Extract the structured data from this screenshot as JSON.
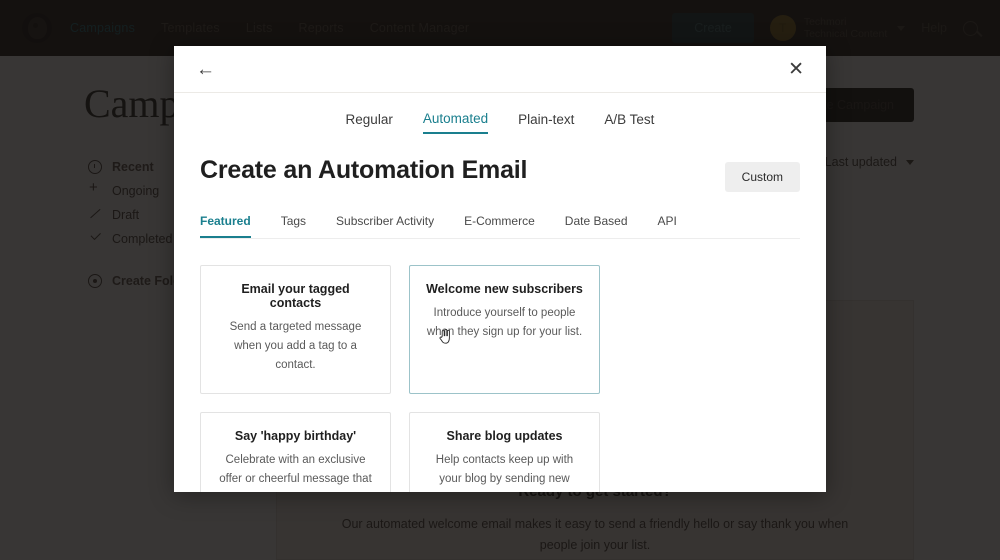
{
  "topnav": {
    "logo_alt": "Mailchimp",
    "links": [
      {
        "label": "Campaigns",
        "active": true
      },
      {
        "label": "Templates",
        "active": false
      },
      {
        "label": "Lists",
        "active": false
      },
      {
        "label": "Reports",
        "active": false
      },
      {
        "label": "Content Manager",
        "active": false
      }
    ],
    "create_label": "Create",
    "account": {
      "initial": "T",
      "name": "Techmori",
      "org": "Technical Content"
    },
    "help_label": "Help"
  },
  "page": {
    "title": "Campaigns",
    "create_campaign_label": "Create Campaign",
    "sort_label": "Last updated",
    "sidebar": [
      {
        "label": "Recent",
        "icon": "clock-icon",
        "active": true
      },
      {
        "label": "Ongoing",
        "icon": "plus-icon",
        "active": false
      },
      {
        "label": "Draft",
        "icon": "pencil-icon",
        "active": false
      },
      {
        "label": "Completed",
        "icon": "check-icon",
        "active": false
      },
      {
        "label": "Create Folder",
        "icon": "target-icon",
        "active": false
      }
    ],
    "promo": {
      "heading": "Ready to get started?",
      "body": "Our automated welcome email makes it easy to send a friendly hello or say thank you when people join your list."
    }
  },
  "modal": {
    "back_icon": "←",
    "close_icon": "✕",
    "tabs": [
      {
        "label": "Regular",
        "active": false
      },
      {
        "label": "Automated",
        "active": true
      },
      {
        "label": "Plain-text",
        "active": false
      },
      {
        "label": "A/B Test",
        "active": false
      }
    ],
    "title": "Create an Automation Email",
    "custom_label": "Custom",
    "subtabs": [
      {
        "label": "Featured",
        "active": true
      },
      {
        "label": "Tags",
        "active": false
      },
      {
        "label": "Subscriber Activity",
        "active": false
      },
      {
        "label": "E-Commerce",
        "active": false
      },
      {
        "label": "Date Based",
        "active": false
      },
      {
        "label": "API",
        "active": false
      }
    ],
    "cards": [
      {
        "title": "Email your tagged contacts",
        "desc": "Send a targeted message when you add a tag to a contact.",
        "selected": false
      },
      {
        "title": "Welcome new subscribers",
        "desc": "Introduce yourself to people when they sign up for your list.",
        "selected": true
      },
      {
        "title": "Say 'happy birthday'",
        "desc": "Celebrate with an exclusive offer or cheerful message that sends based on the birthday field in your list.",
        "selected": false
      },
      {
        "title": "Share blog updates",
        "desc": "Help contacts keep up with your blog by sending new posts straight to their inboxes.",
        "selected": false
      }
    ]
  },
  "colors": {
    "accent_teal": "#1a7f8e",
    "nav_dark": "#241c15",
    "selected_border": "#9cc3c9"
  }
}
